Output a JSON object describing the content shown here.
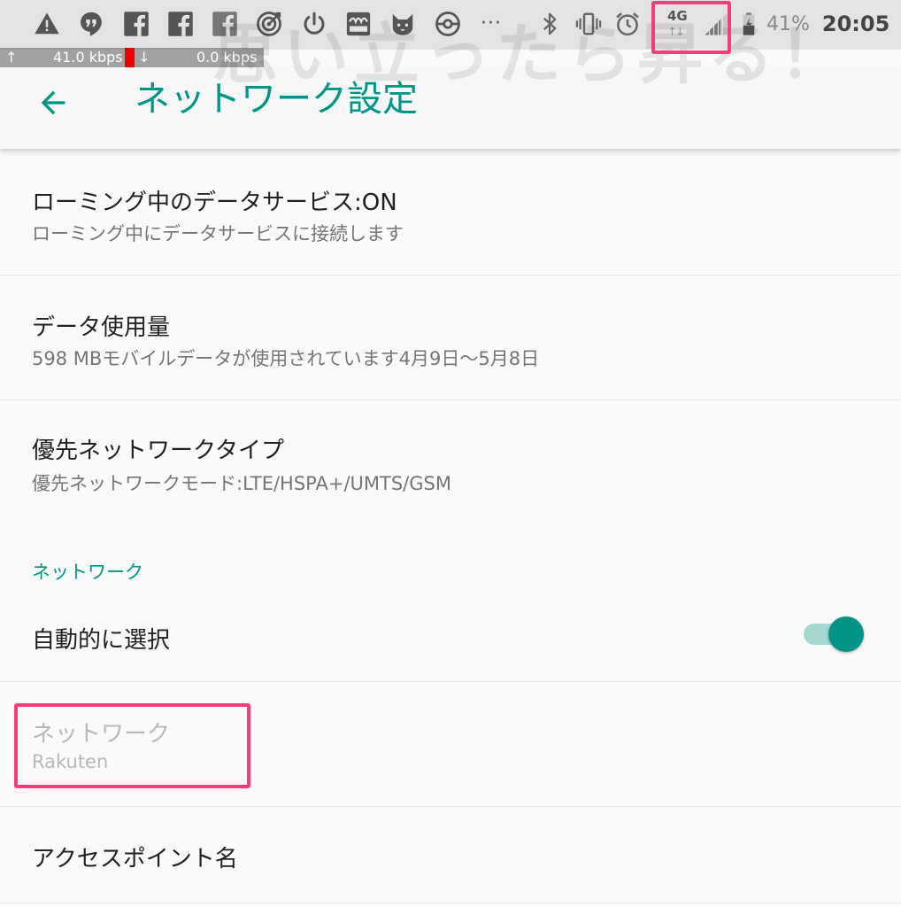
{
  "watermark": "思い立ったら昇る！",
  "status_bar": {
    "notification_icons": [
      "warning-icon",
      "hangouts-icon",
      "facebook-icon",
      "facebook-icon",
      "facebook-lite-icon",
      "target-icon",
      "power-icon",
      "rakuma-icon",
      "cat-icon",
      "pokeball-icon"
    ],
    "more_label": "···",
    "system_icons": [
      "bluetooth-icon",
      "vibrate-icon",
      "alarm-icon"
    ],
    "network_type": "4G",
    "network_arrows": "↑↓",
    "battery_percent": "41%",
    "time": "20:05",
    "upload_arrow": "↑",
    "upload_speed": "41.0 kbps",
    "download_arrow": "↓",
    "download_speed": "0.0 kbps",
    "highlight_color": "#f43d7e"
  },
  "app_bar": {
    "title": "ネットワーク設定"
  },
  "settings": {
    "roaming": {
      "title": "ローミング中のデータサービス:ON",
      "summary": "ローミング中にデータサービスに接続します"
    },
    "data_usage": {
      "title": "データ使用量",
      "summary": "598 MBモバイルデータが使用されています4月9日～5月8日"
    },
    "preferred_network": {
      "title": "優先ネットワークタイプ",
      "summary": "優先ネットワークモード:LTE/HSPA+/UMTS/GSM"
    },
    "network_section_header": "ネットワーク",
    "auto_select": {
      "title": "自動的に選択",
      "enabled": true
    },
    "network": {
      "title": "ネットワーク",
      "summary": "Rakuten"
    },
    "apn": {
      "title": "アクセスポイント名"
    }
  },
  "colors": {
    "accent": "#009587",
    "toggle_track": "#a6d8d3",
    "highlight": "#f43d7e"
  }
}
